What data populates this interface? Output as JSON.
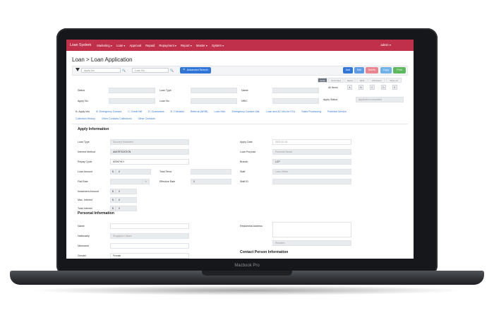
{
  "device": {
    "label": "Macbook Pro"
  },
  "navbar": {
    "brand": "Loan System",
    "items": [
      "Marketing ▾",
      "Loan ▾",
      "Approval",
      "Repaid",
      "Repayment ▾",
      "Report ▾",
      "Master ▾",
      "System ▾"
    ],
    "user": "admin ▾"
  },
  "page": {
    "title": "Loan > Loan Application"
  },
  "toolbar": {
    "search1_placeholder": "Apply No.",
    "search2_placeholder": "Loan No.",
    "advanced": "Advanced Search",
    "add": "Add",
    "edit": "Edit",
    "delete": "Delete",
    "copy": "Copy",
    "print": "Print"
  },
  "status_tabs": [
    "Apply",
    "Submitted",
    "Reject",
    "Wkflt",
    "Withdrawn",
    "Write-off"
  ],
  "all_items": {
    "label": "All Items",
    "options": [
      "A",
      "B",
      "C",
      "D",
      "E"
    ]
  },
  "summary": {
    "status_label": "Status",
    "loan_type_label": "Loan Type",
    "name_label": "Name",
    "apply_no_label": "Apply No.",
    "loan_no_label": "Loan No.",
    "nric_label": "NRIC",
    "apply_status_label": "Apply Status",
    "apply_status_value": "Application completed"
  },
  "tabs": [
    "A. Apply Info",
    "B. Emergency Contact",
    "C. Credit Bill",
    "D. Guarantors",
    "E. Checklist",
    "Referral (NRIB)",
    "Loan Hist.",
    "Emergency Contact Hist.",
    "Loan and AC Info for ECs",
    "Sales Processing",
    "Potential Service",
    "Collection History",
    "Other Contacts Collections",
    "Other Contacts"
  ],
  "apply_info": {
    "header": "Apply Information",
    "loan_type_label": "Loan Type",
    "loan_type_value": "Secured Instalment",
    "interest_method_label": "Interest Method",
    "interest_method_value": "AMORTIZATION",
    "repay_cycle_label": "Repay Cycle",
    "repay_cycle_value": "MONTHLY",
    "loan_amount_label": "Loan Amount",
    "loan_amount_currency": "$",
    "loan_amount_value": "0",
    "flat_rate_label": "Flat Rate",
    "flat_rate_unit": "%",
    "instalment_amount_label": "Instalment Amount",
    "instalment_amount_currency": "$",
    "instalment_amount_value": "0",
    "max_interest_label": "Max. Interest",
    "max_interest_currency": "$",
    "max_interest_value": "0",
    "total_interest_label": "Total Interest",
    "total_interest_currency": "$",
    "total_interest_value": "0",
    "total_tenor_label": "Total Tenor",
    "effective_rate_label": "Effective Rate",
    "effective_rate_value": "0",
    "apply_date_label": "Apply Date",
    "apply_date_value": "2023-10-30",
    "loan_purpose_label": "Loan Purpose",
    "loan_purpose_value": "Personal Needs",
    "branch_label": "Branch",
    "branch_value": "LCP",
    "staff_label": "Staff",
    "staff_value": "Loan Officer",
    "staff_id_label": "Staff ID"
  },
  "personal_info": {
    "header": "Personal Information",
    "name_label": "Name",
    "nationality_label": "Nationality",
    "nationality_value": "Singapore Citizen",
    "nickname_label": "Nickname",
    "gender_label": "Gender",
    "gender_value": "Female",
    "residential_address_label": "Residential Address",
    "resident_status_value": "Resident"
  },
  "contact_person": {
    "header": "Contact Person Information"
  }
}
